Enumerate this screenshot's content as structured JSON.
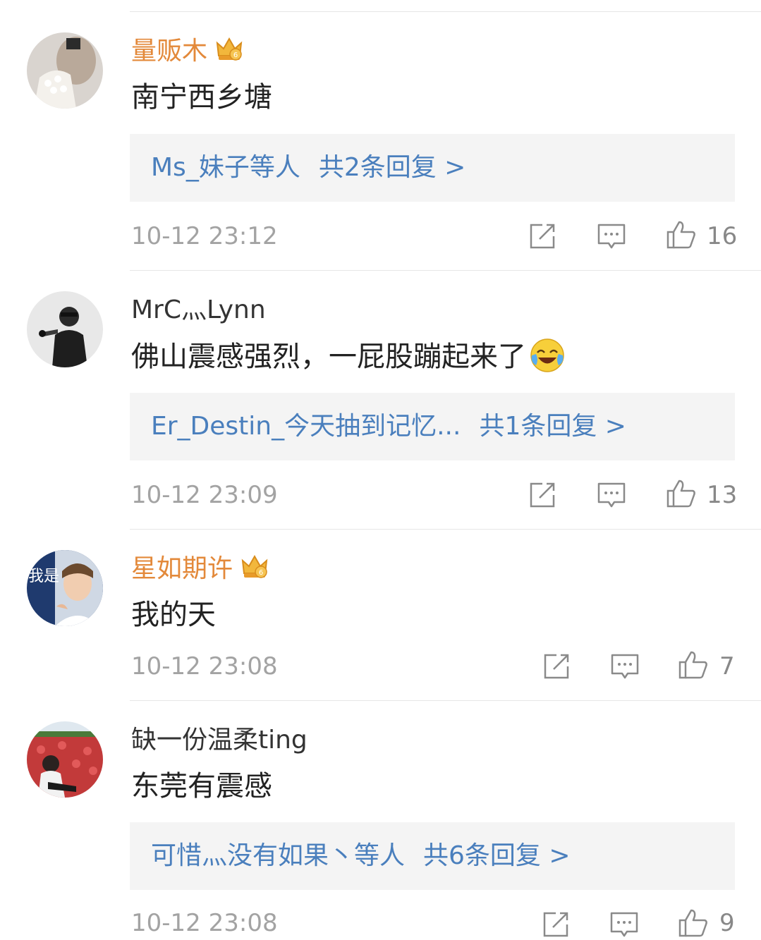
{
  "comments": [
    {
      "username": "量贩木",
      "vip": true,
      "text": "南宁西乡塘",
      "emoji": "",
      "replies": {
        "preview": "Ms_妹子等人",
        "count": "共2条回复 >"
      },
      "time": "10-12 23:12",
      "likes": "16",
      "avatar": "avatar-woman-white-lace"
    },
    {
      "username": "MrC灬Lynn",
      "vip": false,
      "text": "佛山震感强烈，一屁股蹦起来了",
      "emoji": "laughing-crying-emoji",
      "replies": {
        "preview": "Er_Destin_今天抽到记忆...",
        "count": "共1条回复 >"
      },
      "time": "10-12 23:09",
      "likes": "13",
      "avatar": "avatar-singer-microphone"
    },
    {
      "username": "星如期许",
      "vip": true,
      "text": "我的天",
      "emoji": "",
      "replies": null,
      "time": "10-12 23:08",
      "likes": "7",
      "avatar": "avatar-young-man-text",
      "avatar_text": "我是"
    },
    {
      "username": "缺一份温柔ting",
      "vip": false,
      "text": "东莞有震感",
      "emoji": "",
      "replies": {
        "preview": "可惜灬没有如果丶等人",
        "count": "共6条回复 >"
      },
      "time": "10-12 23:08",
      "likes": "9",
      "avatar": "avatar-girl-flowers"
    }
  ],
  "icons": {
    "repost": "repost-icon",
    "comment": "comment-icon",
    "like": "thumbs-up-icon",
    "vip_badge": "crown-badge-icon"
  },
  "colors": {
    "vip_name": "#e3893a",
    "link_blue": "#4a7fbd",
    "meta_gray": "#a3a3a3",
    "reply_bg": "#f4f4f4"
  }
}
